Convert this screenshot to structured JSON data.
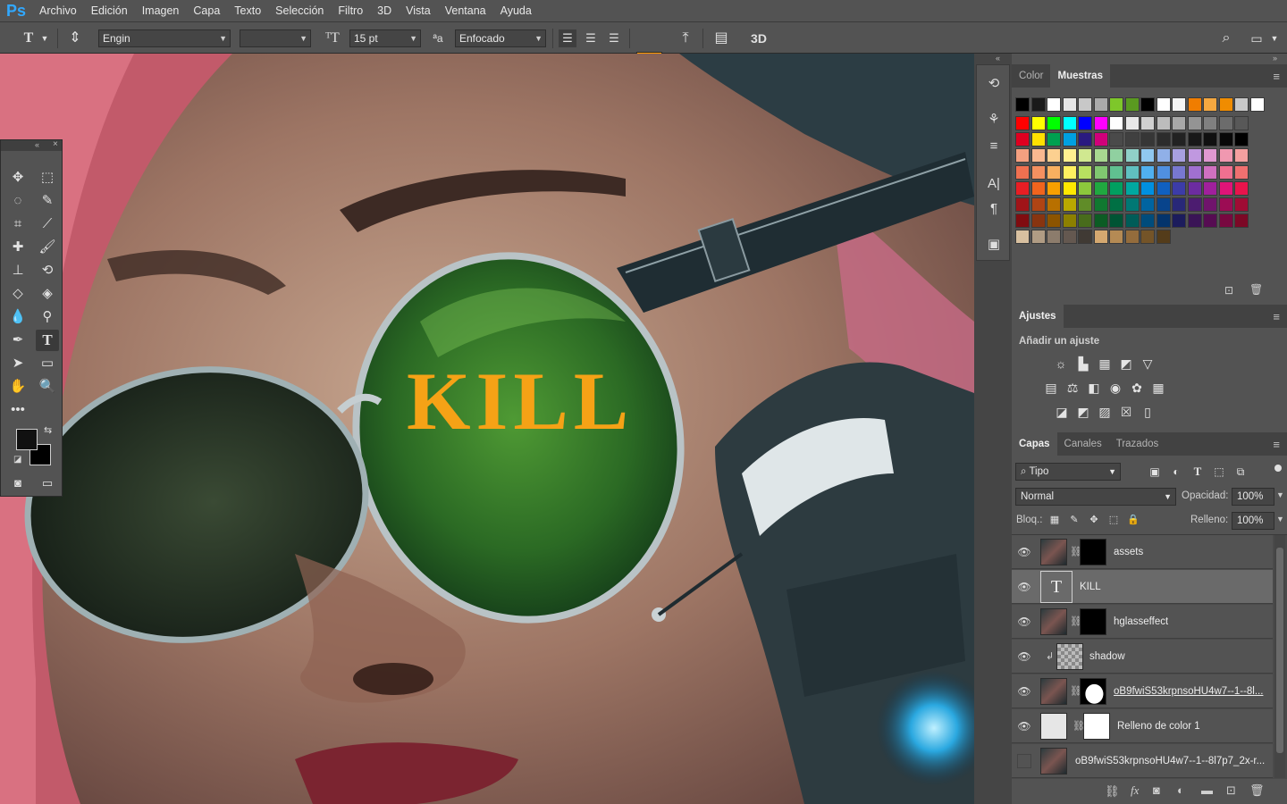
{
  "app": {
    "logo": "Ps"
  },
  "menu": [
    "Archivo",
    "Edición",
    "Imagen",
    "Capa",
    "Texto",
    "Selección",
    "Filtro",
    "3D",
    "Vista",
    "Ventana",
    "Ayuda"
  ],
  "options": {
    "font_family": "Engin",
    "font_size": "15 pt",
    "antialias_label": "ªa",
    "antialias": "Enfocado",
    "text_color": "#ff9a00",
    "three_d_label": "3D"
  },
  "canvas": {
    "text": "KILL",
    "text_color": "#f5a216"
  },
  "colors": {
    "foreground": "#111111",
    "background": "#000000"
  },
  "color_panel": {
    "tabs": [
      "Color",
      "Muestras"
    ],
    "active": "Muestras"
  },
  "adjustments": {
    "title": "Ajustes",
    "subtitle": "Añadir un ajuste"
  },
  "layers_panel": {
    "tabs": [
      "Capas",
      "Canales",
      "Trazados"
    ],
    "filter": "Tipo",
    "blend_mode": "Normal",
    "opacity_label": "Opacidad:",
    "opacity": "100%",
    "lock_label": "Bloq.:",
    "fill_label": "Relleno:",
    "fill": "100%",
    "layers": [
      {
        "name": "assets",
        "visible": true
      },
      {
        "name": "KILL",
        "visible": true,
        "selected": true
      },
      {
        "name": "hglasseffect",
        "visible": true
      },
      {
        "name": "shadow",
        "visible": true
      },
      {
        "name": "oB9fwiS53krpnsoHU4w7--1--8l...",
        "visible": true
      },
      {
        "name": "Relleno de color 1",
        "visible": true
      },
      {
        "name": "oB9fwiS53krpnsoHU4w7--1--8l7p7_2x-r...",
        "visible": false
      }
    ]
  }
}
